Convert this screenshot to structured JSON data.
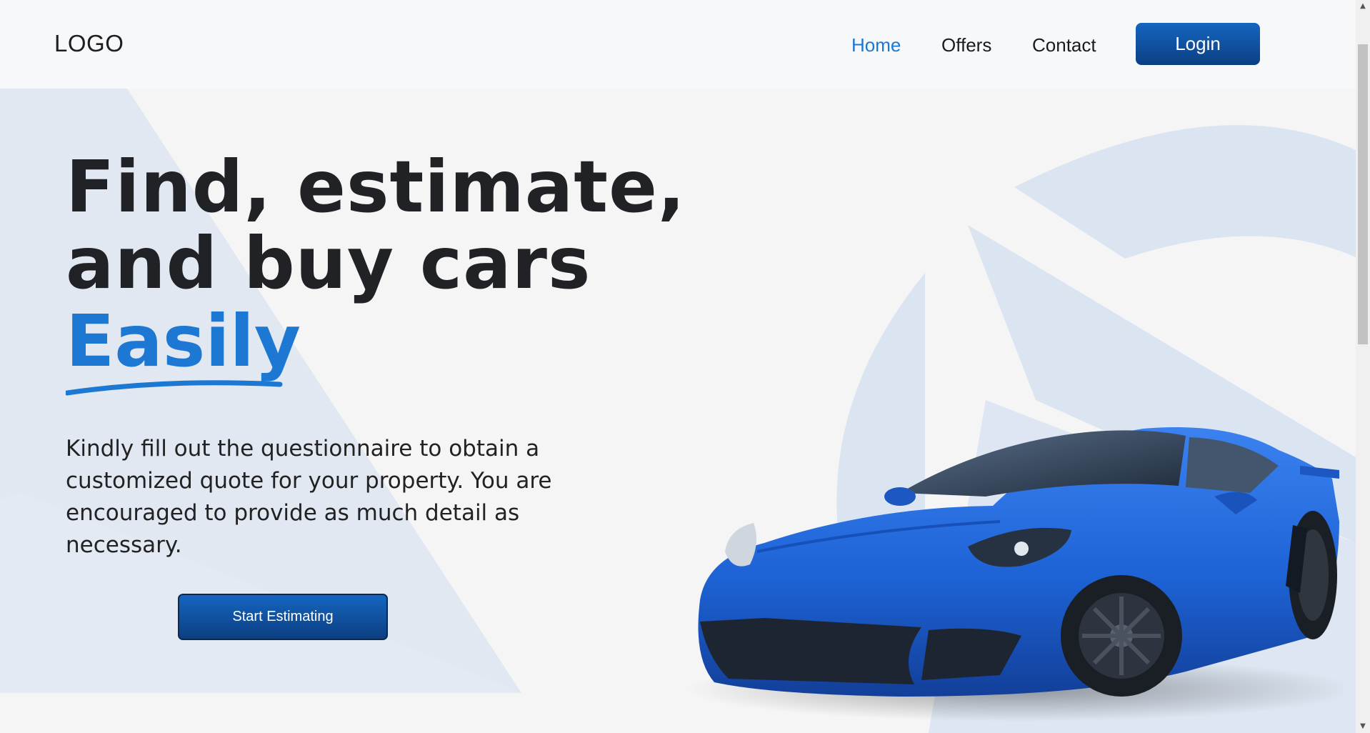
{
  "header": {
    "logo": "LOGO",
    "nav": [
      {
        "label": "Home",
        "active": true
      },
      {
        "label": "Offers",
        "active": false
      },
      {
        "label": "Contact",
        "active": false
      }
    ],
    "login_label": "Login"
  },
  "hero": {
    "title_line1": "Find, estimate,",
    "title_line2": "and buy cars",
    "title_accent": "Easily",
    "description": "Kindly fill out the questionnaire to obtain a customized quote for your property. You are encouraged to provide as much detail as necessary.",
    "cta_label": "Start Estimating"
  },
  "colors": {
    "accent": "#1c78d2",
    "button_top": "#1565c0",
    "button_bottom": "#0c3f82",
    "car_blue": "#1e63d6",
    "shape_blue": "#dbe5f1"
  },
  "scrollbar": {
    "up_icon": "triangle-up",
    "down_icon": "triangle-down"
  }
}
